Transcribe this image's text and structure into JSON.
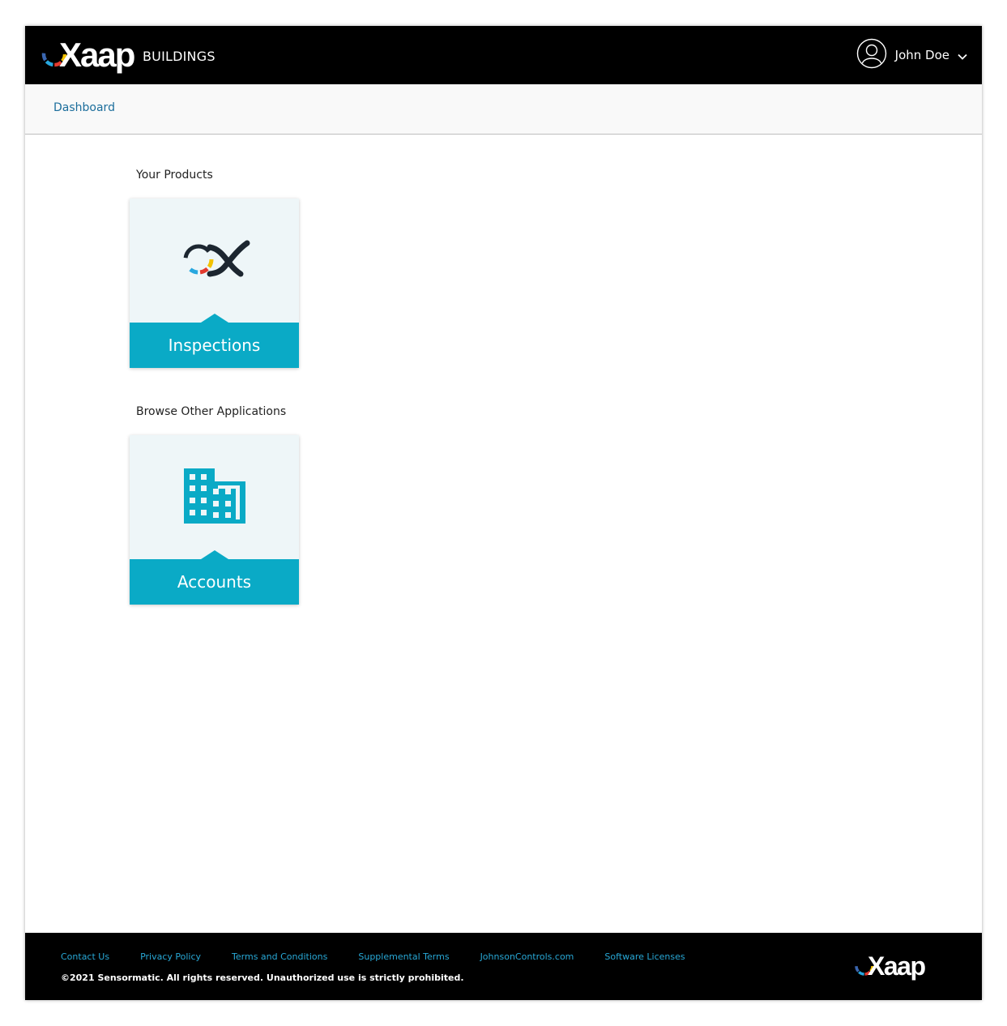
{
  "header": {
    "brand_logo_text": "Xaap",
    "brand_sub": "BUILDINGS",
    "user_name": "John Doe",
    "icons": {
      "user": "user-circle-icon",
      "chevron": "chevron-down-icon"
    }
  },
  "breadcrumb": {
    "dashboard": "Dashboard"
  },
  "sections": {
    "products_label": "Your Products",
    "browse_label": "Browse Other Applications"
  },
  "tiles": {
    "inspections": {
      "label": "Inspections",
      "icon": "xaap-x-icon"
    },
    "accounts": {
      "label": "Accounts",
      "icon": "building-icon"
    }
  },
  "footer": {
    "links": [
      "Contact Us",
      "Privacy Policy",
      "Terms and Conditions",
      "Supplemental Terms",
      "JohnsonControls.com",
      "Software Licenses"
    ],
    "copyright": "©2021 Sensormatic. All rights reserved. Unauthorized use is strictly prohibited.",
    "logo_text": "Xaap"
  },
  "colors": {
    "accent": "#0aaac6",
    "topbar": "#000000",
    "link": "#1c6e9c",
    "footer_link": "#28a8d6",
    "logo_segments": [
      "#f2c200",
      "#e23a2e",
      "#27a7df",
      "#3a66b0"
    ]
  }
}
